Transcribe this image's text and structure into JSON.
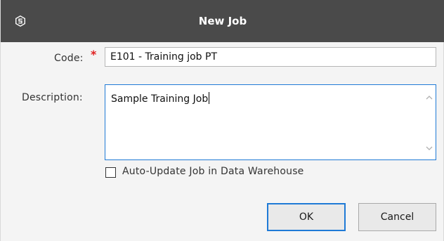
{
  "window": {
    "title": "New Job",
    "app_icon": "app-logo-icon"
  },
  "form": {
    "code": {
      "label": "Code:",
      "required_marker": "*",
      "value": "E101 - Training job PT"
    },
    "description": {
      "label": "Description:",
      "value": "Sample Training Job",
      "scroll_up_icon": "chevron-up-icon",
      "scroll_down_icon": "chevron-down-icon"
    },
    "auto_update": {
      "label": "Auto-Update Job in Data Warehouse",
      "checked": false
    }
  },
  "buttons": {
    "ok_label": "OK",
    "cancel_label": "Cancel"
  },
  "colors": {
    "titlebar": "#4a4a4a",
    "focus_border": "#1f7ad6",
    "required": "#e02020"
  }
}
